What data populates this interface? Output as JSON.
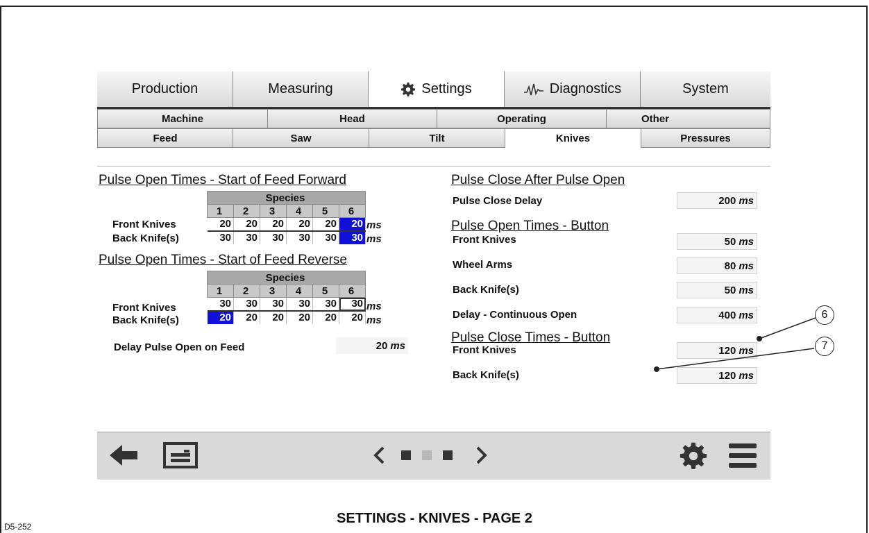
{
  "main_tabs": [
    "Production",
    "Measuring",
    "Settings",
    "Diagnostics",
    "System"
  ],
  "sub_tabs_row1": [
    "Machine",
    "Head",
    "Operating",
    "Other"
  ],
  "sub_tabs_row2": [
    "Feed",
    "Saw",
    "Tilt",
    "Knives",
    "Pressures"
  ],
  "forward": {
    "heading": "Pulse Open Times - Start of Feed Forward",
    "species_label": "Species",
    "species": [
      "1",
      "2",
      "3",
      "4",
      "5",
      "6"
    ],
    "rows": [
      {
        "label": "Front Knives",
        "values": [
          "20",
          "20",
          "20",
          "20",
          "20",
          "20"
        ],
        "unit": "ms"
      },
      {
        "label": "Back Knife(s)",
        "values": [
          "30",
          "30",
          "30",
          "30",
          "30",
          "30"
        ],
        "unit": "ms"
      }
    ]
  },
  "reverse": {
    "heading": "Pulse Open Times - Start of Feed Reverse",
    "species_label": "Species",
    "species": [
      "1",
      "2",
      "3",
      "4",
      "5",
      "6"
    ],
    "rows": [
      {
        "label": "Front Knives",
        "values": [
          "30",
          "30",
          "30",
          "30",
          "30",
          "30"
        ],
        "unit": "ms"
      },
      {
        "label": "Back Knife(s)",
        "values": [
          "20",
          "20",
          "20",
          "20",
          "20",
          "20"
        ],
        "unit": "ms"
      }
    ]
  },
  "delay_pulse_open": {
    "label": "Delay Pulse Open on Feed",
    "value": "20",
    "unit": "ms"
  },
  "close_after_open": {
    "heading": "Pulse Close After Pulse Open",
    "items": [
      {
        "label": "Pulse Close Delay",
        "value": "200",
        "unit": "ms"
      }
    ]
  },
  "open_button": {
    "heading": "Pulse Open Times - Button",
    "items": [
      {
        "label": "Front Knives",
        "value": "50",
        "unit": "ms"
      },
      {
        "label": "Wheel Arms",
        "value": "80",
        "unit": "ms"
      },
      {
        "label": "Back Knife(s)",
        "value": "50",
        "unit": "ms"
      },
      {
        "label": "Delay - Continuous Open",
        "value": "400",
        "unit": "ms"
      }
    ]
  },
  "close_button": {
    "heading": "Pulse Close Times - Button",
    "items": [
      {
        "label": "Front Knives",
        "value": "120",
        "unit": "ms"
      },
      {
        "label": "Back Knife(s)",
        "value": "120",
        "unit": "ms"
      }
    ]
  },
  "callouts": [
    "6",
    "7"
  ],
  "caption": "SETTINGS - KNIVES - PAGE 2",
  "figure_id": "D5-252",
  "colors": {
    "highlight": "#1010d8",
    "toolbar": "#d9d9d9"
  }
}
